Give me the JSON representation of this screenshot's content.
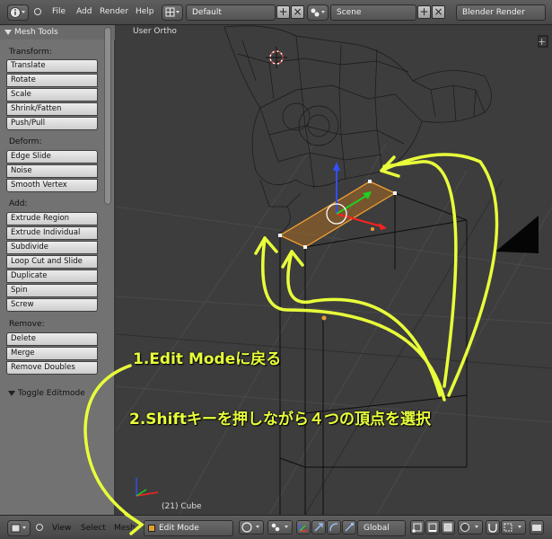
{
  "top_header": {
    "menus": [
      "File",
      "Add",
      "Render",
      "Help"
    ],
    "screen_layout": "Default",
    "scene": "Scene",
    "render_engine": "Blender Render",
    "add_symbol": "+",
    "close_symbol": "×"
  },
  "tool_shelf": {
    "title": "Mesh Tools",
    "sections": {
      "transform": {
        "label": "Transform:",
        "buttons": [
          "Translate",
          "Rotate",
          "Scale",
          "Shrink/Fatten",
          "Push/Pull"
        ]
      },
      "deform": {
        "label": "Deform:",
        "buttons": [
          "Edge Slide",
          "Noise",
          "Smooth Vertex"
        ]
      },
      "add": {
        "label": "Add:",
        "buttons": [
          "Extrude Region",
          "Extrude Individual",
          "Subdivide",
          "Loop Cut and Slide",
          "Duplicate",
          "Spin",
          "Screw"
        ]
      },
      "remove": {
        "label": "Remove:",
        "buttons": [
          "Delete",
          "Merge",
          "Remove Doubles"
        ]
      }
    },
    "toggle_panel": "Toggle Editmode"
  },
  "viewport": {
    "view_label": "User Ortho",
    "object_label": "(21) Cube"
  },
  "bottom_header": {
    "menus": [
      "View",
      "Select",
      "Mesh"
    ],
    "mode": "Edit Mode",
    "orientation": "Global"
  },
  "annotations": {
    "step1": "1.Edit Modeに戻る",
    "step2": "2.Shiftキーを押しながら４つの頂点を選択"
  },
  "colors": {
    "annotation": "#e8ff3a",
    "selection": "#f0a030",
    "toolbar_bg": "#727272"
  }
}
